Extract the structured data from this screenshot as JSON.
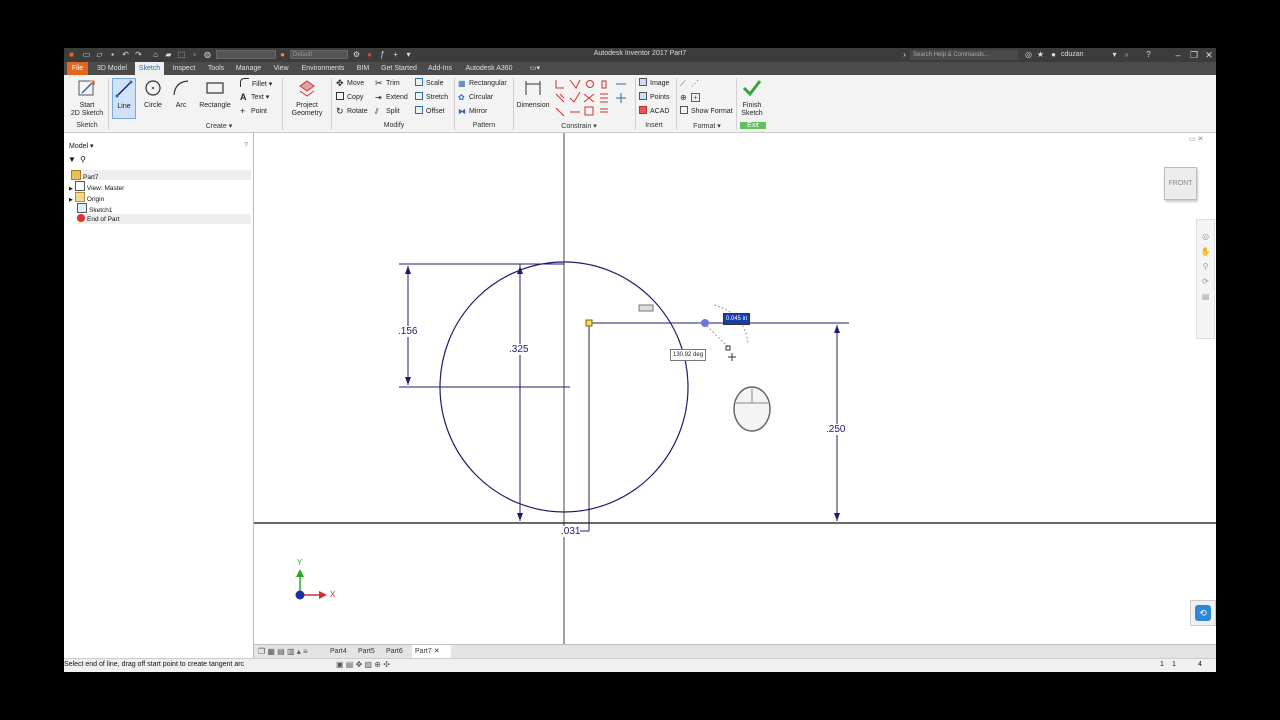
{
  "app": {
    "title": "Autodesk Inventor 2017   Part7",
    "style_dropdown": "Default",
    "search_placeholder": "Search Help & Commands...",
    "user": "cduzan"
  },
  "tabs": [
    "File",
    "3D Model",
    "Sketch",
    "Inspect",
    "Tools",
    "Manage",
    "View",
    "Environments",
    "BIM",
    "Get Started",
    "Add-Ins",
    "Autodesk A360"
  ],
  "ribbon": {
    "start_sketch": "Start\n2D Sketch",
    "line": "Line",
    "circle": "Circle",
    "arc": "Arc",
    "rectangle": "Rectangle",
    "fillet": "Fillet",
    "text": "Text",
    "point": "Point",
    "project_geometry": "Project\nGeometry",
    "move": "Move",
    "copy": "Copy",
    "rotate": "Rotate",
    "trim": "Trim",
    "extend": "Extend",
    "split": "Split",
    "scale": "Scale",
    "stretch": "Stretch",
    "offset": "Offset",
    "rectangular": "Rectangular",
    "circular": "Circular",
    "mirror": "Mirror",
    "dimension": "Dimension",
    "image": "Image",
    "points": "Points",
    "acad": "ACAD",
    "show_format": "Show Format",
    "finish_sketch": "Finish\nSketch",
    "groups": {
      "sketch": "Sketch",
      "create": "Create",
      "modify": "Modify",
      "pattern": "Pattern",
      "constrain": "Constrain",
      "insert": "Insert",
      "format": "Format",
      "exit": "Exit"
    }
  },
  "browser": {
    "header": "Model",
    "items": [
      "Part7",
      "View: Master",
      "Origin",
      "Sketch1",
      "End of Part"
    ]
  },
  "viewcube": "FRONT",
  "sketch": {
    "dim_156": ".156",
    "dim_325": ".325",
    "dim_250": ".250",
    "dim_031": ".031",
    "input_length": "0.045 in",
    "input_angle": "130.92 deg"
  },
  "axes": {
    "y": "Y",
    "x": "X"
  },
  "doc_tabs": [
    "Part4",
    "Part5",
    "Part6",
    "Part7"
  ],
  "status": {
    "message": "Select end of line, drag off start point to create tangent arc",
    "right1": "1",
    "right2": "1",
    "right3": "4"
  },
  "colors": {
    "sketch_line": "#1c1c6e",
    "file_tab": "#e06820",
    "active_blue": "#2a6ab0",
    "finish_green": "#3aa53a"
  }
}
